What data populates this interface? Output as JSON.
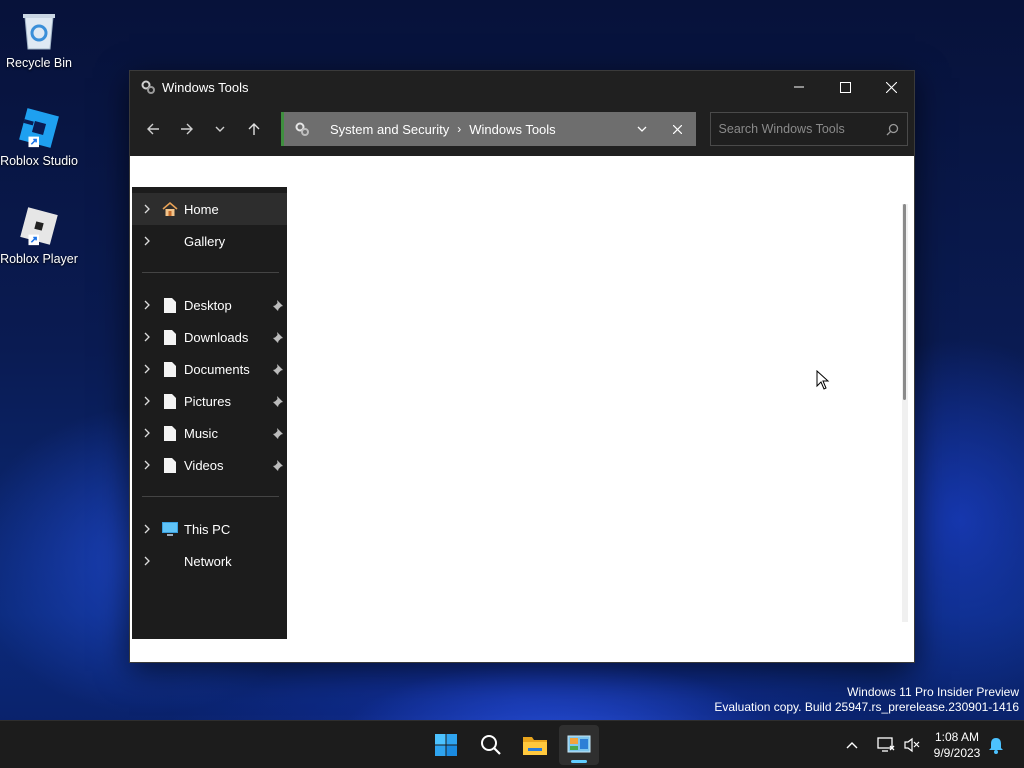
{
  "desktop": {
    "icons": [
      {
        "label": "Recycle Bin",
        "icon": "recycle-bin-icon"
      },
      {
        "label": "Roblox Studio",
        "icon": "roblox-studio-icon"
      },
      {
        "label": "Roblox Player",
        "icon": "roblox-player-icon"
      }
    ]
  },
  "window": {
    "title": "Windows Tools",
    "address": {
      "breadcrumbs": [
        "System and Security",
        "Windows Tools"
      ],
      "separator": "›"
    },
    "search": {
      "placeholder": "Search Windows Tools"
    },
    "nav_pane": {
      "group1": [
        {
          "label": "Home",
          "icon": "home-icon"
        },
        {
          "label": "Gallery",
          "icon": ""
        }
      ],
      "group2": [
        {
          "label": "Desktop",
          "icon": "document-icon"
        },
        {
          "label": "Downloads",
          "icon": "document-icon"
        },
        {
          "label": "Documents",
          "icon": "document-icon"
        },
        {
          "label": "Pictures",
          "icon": "document-icon"
        },
        {
          "label": "Music",
          "icon": "document-icon"
        },
        {
          "label": "Videos",
          "icon": "document-icon"
        }
      ],
      "group3": [
        {
          "label": "This PC",
          "icon": "monitor-icon"
        },
        {
          "label": "Network",
          "icon": ""
        }
      ]
    }
  },
  "watermark": {
    "line1": "Windows 11 Pro Insider Preview",
    "line2": "Evaluation copy. Build 25947.rs_prerelease.230901-1416"
  },
  "taskbar": {
    "apps": [
      "start-icon",
      "search-icon",
      "file-explorer-icon",
      "control-panel-icon"
    ],
    "clock": {
      "time": "1:08 AM",
      "date": "9/9/2023"
    }
  },
  "colors": {
    "accent": "#60cdff",
    "address_bar": "#6e6e6e",
    "nav_pane": "#1c1c1c"
  }
}
